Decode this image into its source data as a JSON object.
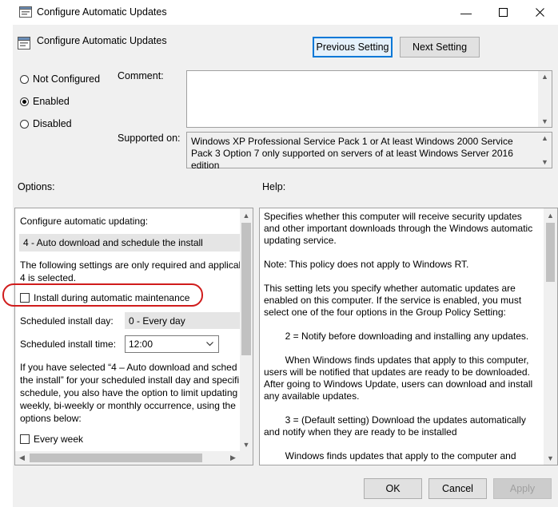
{
  "window": {
    "title": "Configure Automatic Updates",
    "minimize_glyph": "—",
    "maximize_glyph": "☐",
    "close_glyph": "✕"
  },
  "header": {
    "title": "Configure Automatic Updates",
    "prev_label": "Previous Setting",
    "next_label": "Next Setting"
  },
  "state": {
    "options": [
      {
        "label": "Not Configured",
        "selected": false
      },
      {
        "label": "Enabled",
        "selected": true
      },
      {
        "label": "Disabled",
        "selected": false
      }
    ]
  },
  "comment": {
    "label": "Comment:",
    "value": ""
  },
  "supported": {
    "label": "Supported on:",
    "value": "Windows XP Professional Service Pack 1 or At least Windows 2000 Service Pack 3 Option 7 only supported on servers of at least Windows Server 2016 edition"
  },
  "options_panel": {
    "section_label": "Options:",
    "configure_label": "Configure automatic updating:",
    "configure_value": "4 - Auto download and schedule the install",
    "note_line1": "The following settings are only required and applical",
    "note_line2": "4 is selected.",
    "install_maintenance_label": "Install during automatic maintenance",
    "install_day_label": "Scheduled install day:",
    "install_day_value": "0 - Every day",
    "install_time_label": "Scheduled install time:",
    "install_time_value": "12:00",
    "para_lines": [
      "If you have selected “4 – Auto download and sched",
      "the install” for your scheduled install day and specifi",
      "schedule, you also have the option to limit updating",
      "weekly, bi-weekly or monthly occurrence, using the",
      "options below:"
    ],
    "every_week_label": "Every week"
  },
  "help_panel": {
    "section_label": "Help:",
    "text": "Specifies whether this computer will receive security updates and other important downloads through the Windows automatic updating service.\n\nNote: This policy does not apply to Windows RT.\n\nThis setting lets you specify whether automatic updates are enabled on this computer. If the service is enabled, you must select one of the four options in the Group Policy Setting:\n\n        2 = Notify before downloading and installing any updates.\n\n        When Windows finds updates that apply to this computer, users will be notified that updates are ready to be downloaded. After going to Windows Update, users can download and install any available updates.\n\n        3 = (Default setting) Download the updates automatically and notify when they are ready to be installed\n\n        Windows finds updates that apply to the computer and"
  },
  "footer": {
    "ok_label": "OK",
    "cancel_label": "Cancel",
    "apply_label": "Apply"
  },
  "colors": {
    "accent": "#0078d7",
    "annotation": "#d01c1c",
    "dialog_bg": "#f0f0f0"
  },
  "icons": {
    "title": "policy-setting-icon",
    "header": "policy-setting-icon"
  }
}
